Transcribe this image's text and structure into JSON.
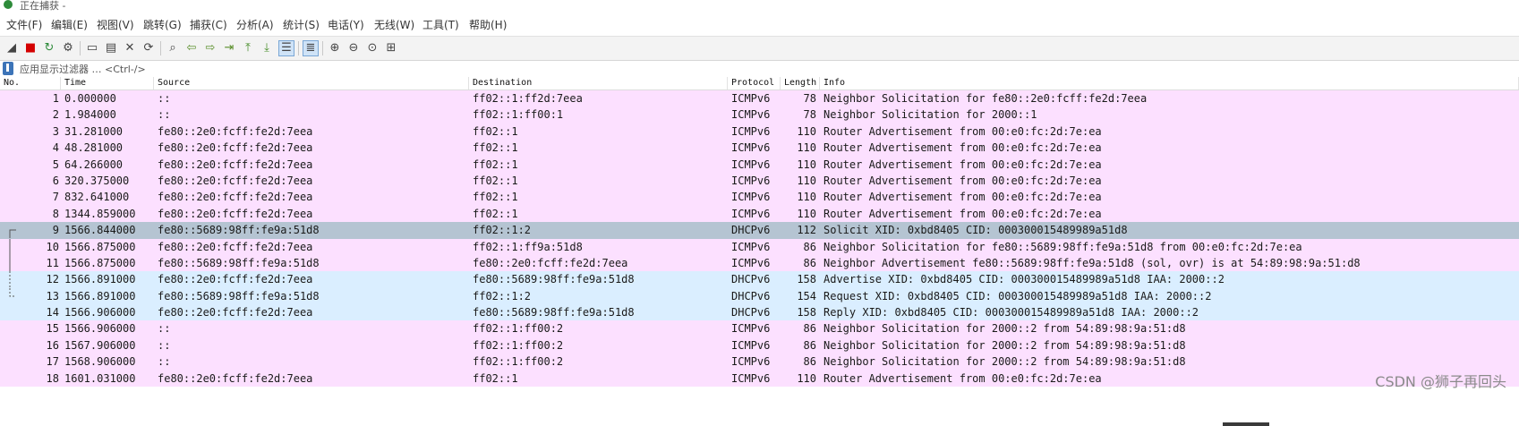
{
  "window": {
    "title": "正在捕获 -"
  },
  "menu": [
    "文件(F)",
    "编辑(E)",
    "视图(V)",
    "跳转(G)",
    "捕获(C)",
    "分析(A)",
    "统计(S)",
    "电话(Y)",
    "无线(W)",
    "工具(T)",
    "帮助(H)"
  ],
  "toolbar": {
    "buttons": [
      {
        "name": "start-capture-icon",
        "glyph": "◢"
      },
      {
        "name": "stop-capture-icon",
        "glyph": "■"
      },
      {
        "name": "restart-capture-icon",
        "glyph": "↻"
      },
      {
        "name": "capture-options-icon",
        "glyph": "⚙"
      },
      {
        "name": "open-file-icon",
        "glyph": "▭"
      },
      {
        "name": "save-file-icon",
        "glyph": "▤"
      },
      {
        "name": "close-file-icon",
        "glyph": "✕"
      },
      {
        "name": "reload-file-icon",
        "glyph": "⟳"
      },
      {
        "name": "find-packet-icon",
        "glyph": "⌕"
      },
      {
        "name": "go-back-icon",
        "glyph": "⇦"
      },
      {
        "name": "go-forward-icon",
        "glyph": "⇨"
      },
      {
        "name": "go-to-packet-icon",
        "glyph": "⇥"
      },
      {
        "name": "go-first-packet-icon",
        "glyph": "⤒"
      },
      {
        "name": "go-last-packet-icon",
        "glyph": "⤓"
      },
      {
        "name": "auto-scroll-icon",
        "glyph": "☰"
      },
      {
        "name": "colorize-icon",
        "glyph": "≣"
      },
      {
        "name": "zoom-in-icon",
        "glyph": "⊕"
      },
      {
        "name": "zoom-out-icon",
        "glyph": "⊖"
      },
      {
        "name": "zoom-reset-icon",
        "glyph": "⊙"
      },
      {
        "name": "resize-columns-icon",
        "glyph": "⊞"
      }
    ]
  },
  "filter": {
    "placeholder": "应用显示过滤器 … <Ctrl-/>"
  },
  "columns": [
    "No.",
    "Time",
    "Source",
    "Destination",
    "Protocol",
    "Length",
    "Info"
  ],
  "packets": [
    {
      "no": "1",
      "time": "0.000000",
      "src": "::",
      "dst": "ff02::1:ff2d:7eea",
      "proto": "ICMPv6",
      "len": "78",
      "info": "Neighbor Solicitation for fe80::2e0:fcff:fe2d:7eea"
    },
    {
      "no": "2",
      "time": "1.984000",
      "src": "::",
      "dst": "ff02::1:ff00:1",
      "proto": "ICMPv6",
      "len": "78",
      "info": "Neighbor Solicitation for 2000::1"
    },
    {
      "no": "3",
      "time": "31.281000",
      "src": "fe80::2e0:fcff:fe2d:7eea",
      "dst": "ff02::1",
      "proto": "ICMPv6",
      "len": "110",
      "info": "Router Advertisement from 00:e0:fc:2d:7e:ea"
    },
    {
      "no": "4",
      "time": "48.281000",
      "src": "fe80::2e0:fcff:fe2d:7eea",
      "dst": "ff02::1",
      "proto": "ICMPv6",
      "len": "110",
      "info": "Router Advertisement from 00:e0:fc:2d:7e:ea"
    },
    {
      "no": "5",
      "time": "64.266000",
      "src": "fe80::2e0:fcff:fe2d:7eea",
      "dst": "ff02::1",
      "proto": "ICMPv6",
      "len": "110",
      "info": "Router Advertisement from 00:e0:fc:2d:7e:ea"
    },
    {
      "no": "6",
      "time": "320.375000",
      "src": "fe80::2e0:fcff:fe2d:7eea",
      "dst": "ff02::1",
      "proto": "ICMPv6",
      "len": "110",
      "info": "Router Advertisement from 00:e0:fc:2d:7e:ea"
    },
    {
      "no": "7",
      "time": "832.641000",
      "src": "fe80::2e0:fcff:fe2d:7eea",
      "dst": "ff02::1",
      "proto": "ICMPv6",
      "len": "110",
      "info": "Router Advertisement from 00:e0:fc:2d:7e:ea"
    },
    {
      "no": "8",
      "time": "1344.859000",
      "src": "fe80::2e0:fcff:fe2d:7eea",
      "dst": "ff02::1",
      "proto": "ICMPv6",
      "len": "110",
      "info": "Router Advertisement from 00:e0:fc:2d:7e:ea"
    },
    {
      "no": "9",
      "time": "1566.844000",
      "src": "fe80::5689:98ff:fe9a:51d8",
      "dst": "ff02::1:2",
      "proto": "DHCPv6",
      "len": "112",
      "info": "Solicit XID: 0xbd8405 CID: 000300015489989a51d8",
      "selected": true
    },
    {
      "no": "10",
      "time": "1566.875000",
      "src": "fe80::2e0:fcff:fe2d:7eea",
      "dst": "ff02::1:ff9a:51d8",
      "proto": "ICMPv6",
      "len": "86",
      "info": "Neighbor Solicitation for fe80::5689:98ff:fe9a:51d8 from 00:e0:fc:2d:7e:ea"
    },
    {
      "no": "11",
      "time": "1566.875000",
      "src": "fe80::5689:98ff:fe9a:51d8",
      "dst": "fe80::2e0:fcff:fe2d:7eea",
      "proto": "ICMPv6",
      "len": "86",
      "info": "Neighbor Advertisement fe80::5689:98ff:fe9a:51d8 (sol, ovr) is at 54:89:98:9a:51:d8"
    },
    {
      "no": "12",
      "time": "1566.891000",
      "src": "fe80::2e0:fcff:fe2d:7eea",
      "dst": "fe80::5689:98ff:fe9a:51d8",
      "proto": "DHCPv6",
      "len": "158",
      "info": "Advertise XID: 0xbd8405 CID: 000300015489989a51d8 IAA: 2000::2"
    },
    {
      "no": "13",
      "time": "1566.891000",
      "src": "fe80::5689:98ff:fe9a:51d8",
      "dst": "ff02::1:2",
      "proto": "DHCPv6",
      "len": "154",
      "info": "Request XID: 0xbd8405 CID: 000300015489989a51d8 IAA: 2000::2"
    },
    {
      "no": "14",
      "time": "1566.906000",
      "src": "fe80::2e0:fcff:fe2d:7eea",
      "dst": "fe80::5689:98ff:fe9a:51d8",
      "proto": "DHCPv6",
      "len": "158",
      "info": "Reply XID: 0xbd8405 CID: 000300015489989a51d8 IAA: 2000::2"
    },
    {
      "no": "15",
      "time": "1566.906000",
      "src": "::",
      "dst": "ff02::1:ff00:2",
      "proto": "ICMPv6",
      "len": "86",
      "info": "Neighbor Solicitation for 2000::2 from 54:89:98:9a:51:d8"
    },
    {
      "no": "16",
      "time": "1567.906000",
      "src": "::",
      "dst": "ff02::1:ff00:2",
      "proto": "ICMPv6",
      "len": "86",
      "info": "Neighbor Solicitation for 2000::2 from 54:89:98:9a:51:d8"
    },
    {
      "no": "17",
      "time": "1568.906000",
      "src": "::",
      "dst": "ff02::1:ff00:2",
      "proto": "ICMPv6",
      "len": "86",
      "info": "Neighbor Solicitation for 2000::2 from 54:89:98:9a:51:d8"
    },
    {
      "no": "18",
      "time": "1601.031000",
      "src": "fe80::2e0:fcff:fe2d:7eea",
      "dst": "ff02::1",
      "proto": "ICMPv6",
      "len": "110",
      "info": "Router Advertisement from 00:e0:fc:2d:7e:ea"
    }
  ],
  "watermark": "CSDN @狮子再回头",
  "colors": {
    "icmp_row": "#fce0ff",
    "dhcp_row": "#daeeff",
    "selected_row": "#b5c4d2"
  }
}
